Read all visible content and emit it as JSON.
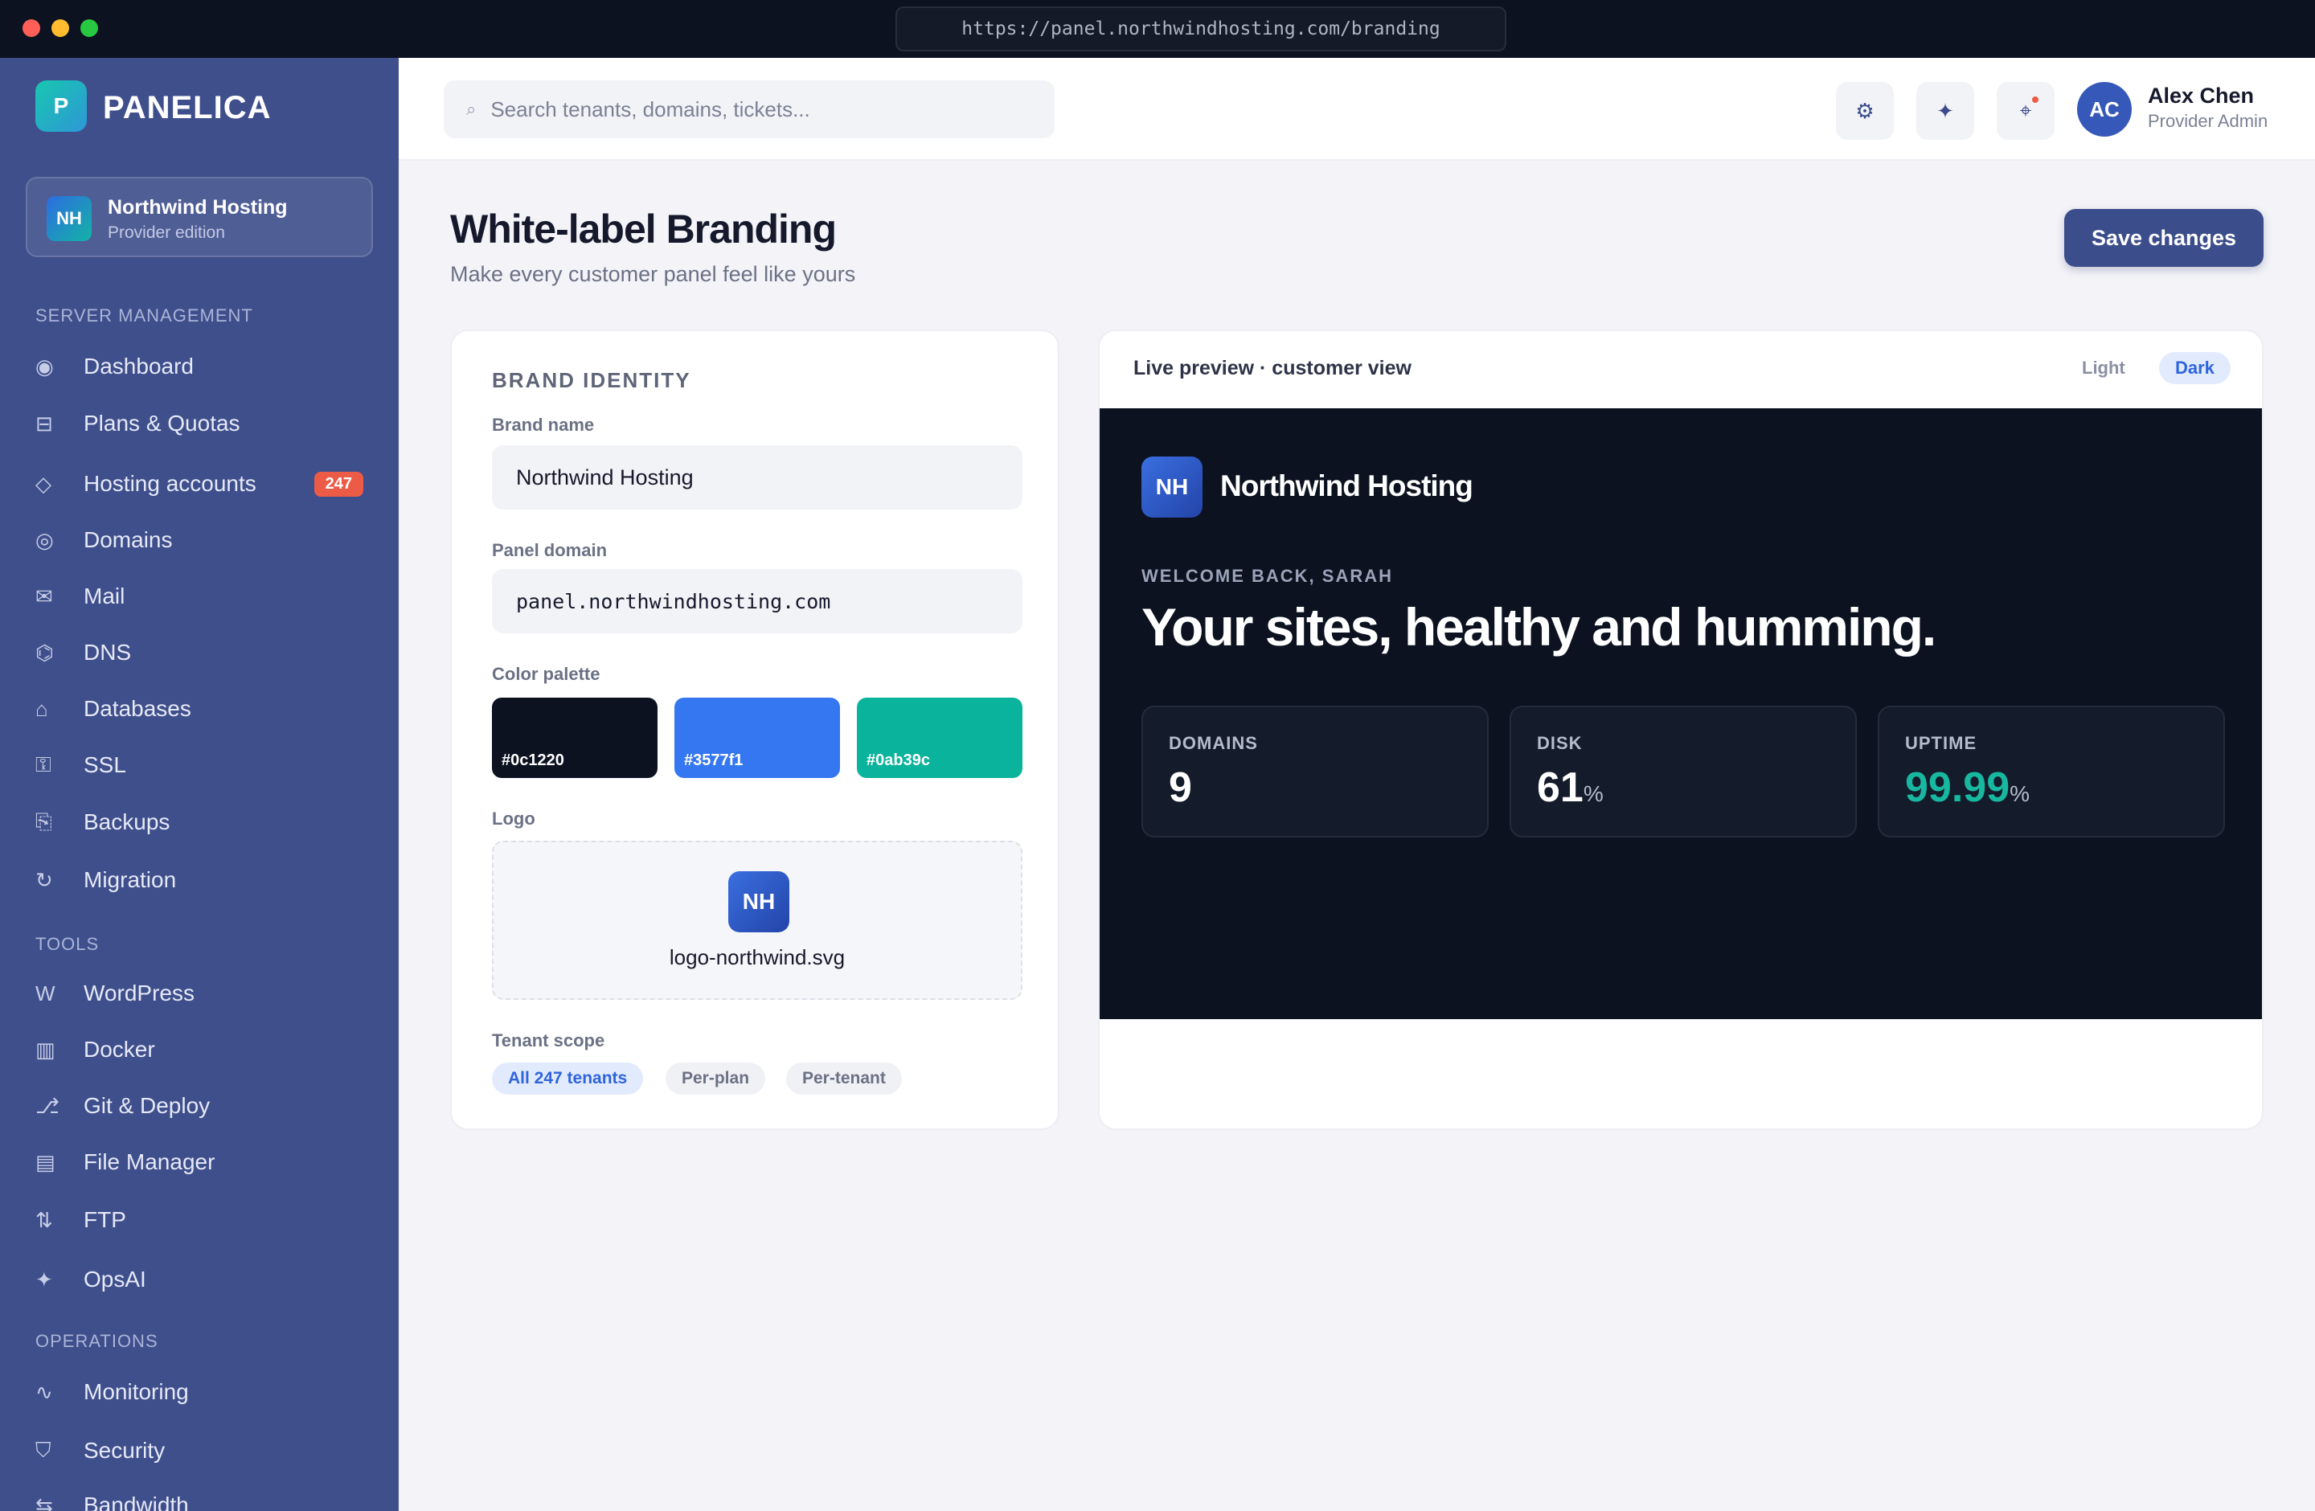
{
  "window": {
    "url": "https://panel.northwindhosting.com/branding"
  },
  "sidebar": {
    "logo_letter": "P",
    "brand": "PANELICA",
    "tenant": {
      "initials": "NH",
      "name": "Northwind Hosting",
      "subtitle": "Provider edition"
    },
    "sections": [
      {
        "title": "SERVER MANAGEMENT",
        "items": [
          {
            "label": "Dashboard",
            "icon": "◉"
          },
          {
            "label": "Plans & Quotas",
            "icon": "⊟"
          },
          {
            "label": "Hosting accounts",
            "icon": "◇",
            "badge": "247"
          },
          {
            "label": "Domains",
            "icon": "◎"
          },
          {
            "label": "Mail",
            "icon": "✉"
          },
          {
            "label": "DNS",
            "icon": "⌬"
          },
          {
            "label": "Databases",
            "icon": "⌂"
          },
          {
            "label": "SSL",
            "icon": "⚿"
          },
          {
            "label": "Backups",
            "icon": "⎘"
          },
          {
            "label": "Migration",
            "icon": "↻"
          }
        ]
      },
      {
        "title": "TOOLS",
        "items": [
          {
            "label": "WordPress",
            "icon": "W"
          },
          {
            "label": "Docker",
            "icon": "▥"
          },
          {
            "label": "Git & Deploy",
            "icon": "⎇"
          },
          {
            "label": "File Manager",
            "icon": "▤"
          },
          {
            "label": "FTP",
            "icon": "⇅"
          },
          {
            "label": "OpsAI",
            "icon": "✦"
          }
        ]
      },
      {
        "title": "OPERATIONS",
        "items": [
          {
            "label": "Monitoring",
            "icon": "∿"
          },
          {
            "label": "Security",
            "icon": "⛉"
          },
          {
            "label": "Bandwidth",
            "icon": "⇆"
          }
        ]
      }
    ]
  },
  "topbar": {
    "search_placeholder": "Search tenants, domains, tickets...",
    "buttons": [
      {
        "name": "settings",
        "icon": "⚙"
      },
      {
        "name": "ai-assist",
        "icon": "✦"
      },
      {
        "name": "notifications",
        "icon": "⌖"
      }
    ],
    "user": {
      "initials": "AC",
      "name": "Alex Chen",
      "role": "Provider Admin"
    }
  },
  "page": {
    "title": "White-label Branding",
    "subtitle": "Make every customer panel feel like yours",
    "save_label": "Save changes"
  },
  "identity": {
    "heading": "BRAND IDENTITY",
    "brand_name_label": "Brand name",
    "brand_name_value": "Northwind Hosting",
    "domain_label": "Panel domain",
    "domain_value": "panel.northwindhosting.com",
    "palette_label": "Color palette",
    "palette": [
      {
        "hex": "#0c1220"
      },
      {
        "hex": "#3577f1"
      },
      {
        "hex": "#0ab39c"
      }
    ],
    "logo_label": "Logo",
    "logo_initials": "NH",
    "logo_filename": "logo-northwind.svg",
    "scope_label": "Tenant scope",
    "scope_options": [
      {
        "label": "All 247 tenants",
        "active": true
      },
      {
        "label": "Per-plan",
        "active": false
      },
      {
        "label": "Per-tenant",
        "active": false
      }
    ]
  },
  "preview": {
    "title": "Live preview · customer view",
    "mode_light": "Light",
    "mode_dark": "Dark",
    "brand_initials": "NH",
    "brand_name": "Northwind Hosting",
    "welcome": "WELCOME BACK, SARAH",
    "headline": "Your sites, healthy and humming.",
    "stats": [
      {
        "label": "DOMAINS",
        "value": "9",
        "unit": ""
      },
      {
        "label": "DISK",
        "value": "61",
        "unit": "%"
      },
      {
        "label": "UPTIME",
        "value": "99.99",
        "unit": "%"
      }
    ]
  }
}
